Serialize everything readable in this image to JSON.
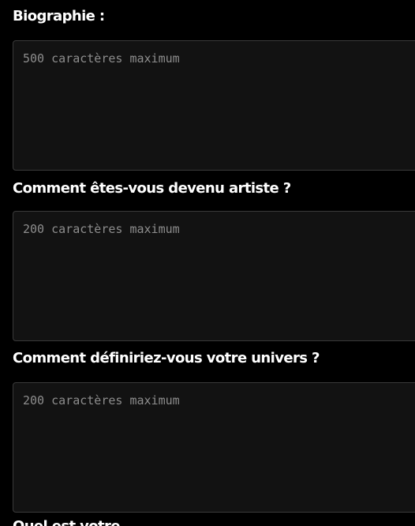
{
  "form": {
    "fields": [
      {
        "label": "Biographie :",
        "placeholder": "500 caractères maximum",
        "value": ""
      },
      {
        "label": "Comment êtes-vous devenu artiste ?",
        "placeholder": "200 caractères maximum",
        "value": ""
      },
      {
        "label": "Comment définiriez-vous votre univers ?",
        "placeholder": "200 caractères maximum",
        "value": ""
      }
    ],
    "next_label_partial": "Quel est votre ..."
  },
  "colors": {
    "background": "#000000",
    "field_background": "#121212",
    "field_border": "#3a3a3a",
    "label_text": "#ffffff",
    "placeholder_text": "#8d8d8d"
  }
}
